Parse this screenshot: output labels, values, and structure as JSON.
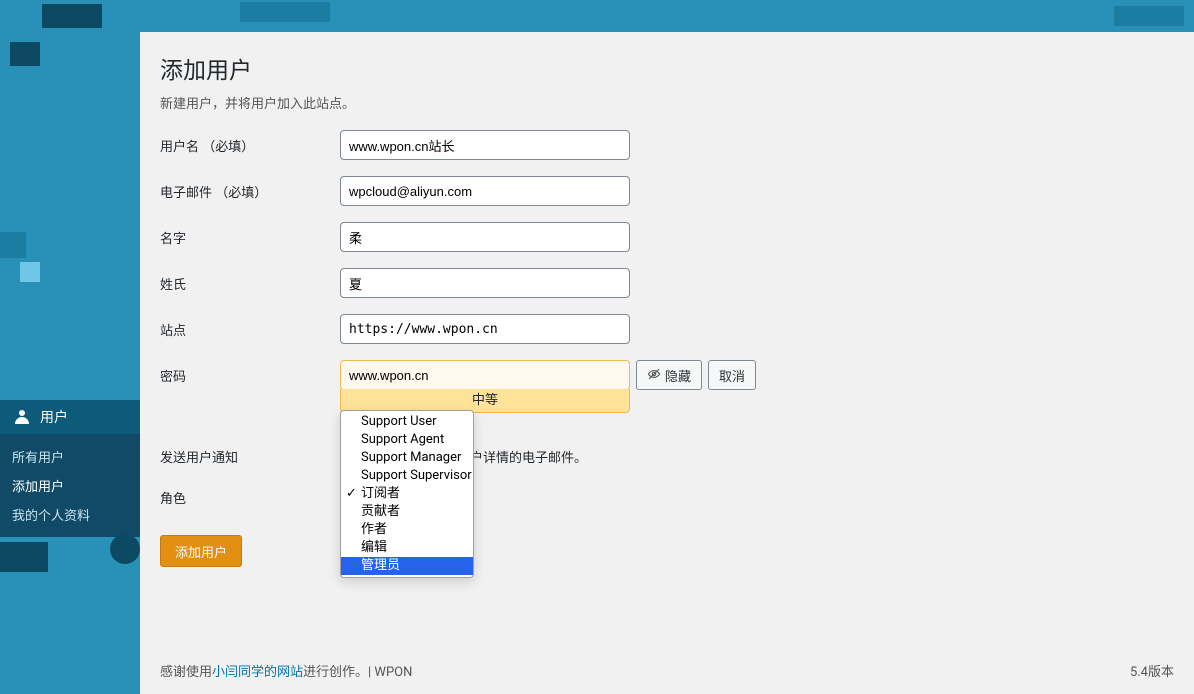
{
  "sidebar": {
    "users_label": "用户",
    "submenu": [
      {
        "label": "所有用户"
      },
      {
        "label": "添加用户"
      },
      {
        "label": "我的个人资料"
      }
    ]
  },
  "page": {
    "title": "添加用户",
    "desc": "新建用户，并将用户加入此站点。"
  },
  "form": {
    "username_label": "用户名 （必填）",
    "username_value": "www.wpon.cn站长",
    "email_label": "电子邮件 （必填）",
    "email_value": "wpcloud@aliyun.com",
    "first_name_label": "名字",
    "first_name_value": "柔",
    "last_name_label": "姓氏",
    "last_name_value": "夏",
    "website_label": "站点",
    "website_value": "https://www.wpon.cn",
    "password_label": "密码",
    "password_value": "www.wpon.cn",
    "hide_btn": "隐藏",
    "cancel_btn": "取消",
    "strength": "中等",
    "notify_label": "发送用户通知",
    "notify_desc": "户详情的电子邮件。",
    "role_label": "角色",
    "submit": "添加用户"
  },
  "role_dropdown": {
    "options": [
      {
        "label": "Support User"
      },
      {
        "label": "Support Agent"
      },
      {
        "label": "Support Manager"
      },
      {
        "label": "Support Supervisor"
      },
      {
        "label": "订阅者",
        "checked": true
      },
      {
        "label": "贡献者"
      },
      {
        "label": "作者"
      },
      {
        "label": "编辑"
      },
      {
        "label": "管理员",
        "highlighted": true
      }
    ]
  },
  "footer": {
    "thanks_prefix": "感谢使用",
    "link": "小闫同学的网站",
    "thanks_suffix": "进行创作。| WPON",
    "version": "5.4版本"
  }
}
